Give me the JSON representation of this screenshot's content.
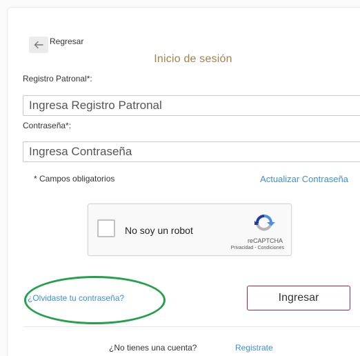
{
  "header": {
    "back_label": "Regresar",
    "title": "Inicio de sesión"
  },
  "form": {
    "registro": {
      "label": "Registro Patronal*:",
      "placeholder": "Ingresa Registro Patronal",
      "value": ""
    },
    "password": {
      "label": "Contraseña*:",
      "placeholder": "Ingresa Contraseña",
      "value": ""
    },
    "required_note": "* Campos obligatorios",
    "update_password_link": "Actualizar Contraseña"
  },
  "recaptcha": {
    "checkbox_label": "No soy un robot",
    "brand": "reCAPTCHA",
    "terms": "Privacidad - Condiciones",
    "checked": false
  },
  "actions": {
    "forgot_password": "¿Olvidaste tu contraseña?",
    "login_button": "Ingresar"
  },
  "footer": {
    "signup_prompt": "¿No tienes una cuenta?",
    "signup_link": "Registrate"
  },
  "colors": {
    "title": "#a57f4b",
    "link": "#3f8fd2",
    "login_border": "#9d2449",
    "highlight": "#23a04a"
  }
}
